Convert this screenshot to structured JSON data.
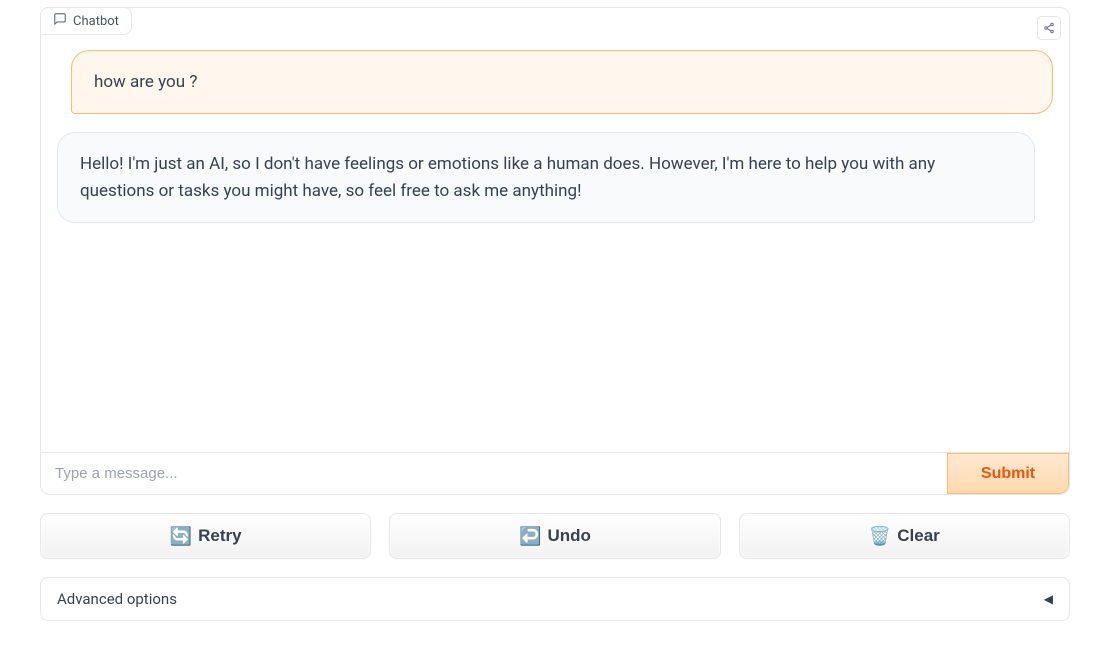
{
  "header": {
    "tab_label": "Chatbot"
  },
  "messages": {
    "user": "how are you ?",
    "assistant": "Hello! I'm just an AI, so I don't have feelings or emotions like a human does. However, I'm here to help you with any questions or tasks you might have, so feel free to ask me anything!"
  },
  "input": {
    "placeholder": "Type a message...",
    "value": ""
  },
  "buttons": {
    "submit": "Submit",
    "retry": "Retry",
    "undo": "Undo",
    "clear": "Clear"
  },
  "icons": {
    "retry": "🔄",
    "undo": "↩️",
    "clear": "🗑️"
  },
  "advanced": {
    "label": "Advanced options",
    "caret": "◀"
  }
}
